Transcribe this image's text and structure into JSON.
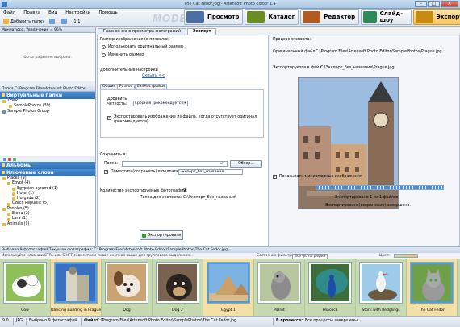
{
  "window": {
    "title": "The Cat Fedor.jpg - Artensoft Photo Editor 1.4",
    "buttons": [
      "–",
      "□",
      "✕"
    ]
  },
  "menu": [
    "Файл",
    "Правка",
    "Вид",
    "Настройки",
    "Помощь"
  ],
  "toolbar": {
    "add_label": "Добавить папку",
    "zoom": "1:1"
  },
  "mode_label": "MODE:",
  "modes": [
    {
      "label": "Просмотр",
      "color": "#4a6fa5"
    },
    {
      "label": "Каталог",
      "color": "#6b8e23"
    },
    {
      "label": "Редактор",
      "color": "#b35a1f"
    },
    {
      "label": "Слайд-шоу",
      "color": "#2e8b57"
    },
    {
      "label": "Экспорт",
      "color": "#c78a12",
      "active": true
    }
  ],
  "left": {
    "preview_header": "Миниатюра. Увеличение = 96%",
    "preview_empty": "Фотография не выбрана.",
    "folder_header": "Папка C:\\Program Files\\Artensoft Photo Editor...",
    "virtual_title": "Виртуальные папки",
    "virtual_tree": [
      "TEMP",
      "SamplePhotos (39)",
      "Sample Photos Group"
    ],
    "albums_title": "Альбомы",
    "keywords_title": "Ключевые слова",
    "keywords_tree": [
      "Places (9)",
      "Egypt (4)",
      "Egyptian pyramid (1)",
      "Hotel (1)",
      "Hurgada (2)",
      "Czech Republic (5)",
      "Peoples (5)",
      "Elena (2)",
      "Lara (1)",
      "Animals (9)"
    ]
  },
  "tabs": [
    "Главное окно просмотра фотографий",
    "Экспорт"
  ],
  "settings": {
    "size_title": "Размер изображения (в пикселях)",
    "size_options": [
      "Использовать оригинальный размер",
      "Изменить размер"
    ],
    "extra_title": "Дополнительные настройки",
    "hide_link": "Скрыть <<",
    "subtabs": [
      "Общие",
      "Разное",
      "ExifНастройки"
    ],
    "quality_label": "Добавить четкость:",
    "quality_value": "Средняя (рекомендуется)",
    "exif_check": "Экспортировать изображение из файла, когда отсутствует оригинал (рекомендуется)",
    "save_title": "Сохранить в:",
    "folder_label": "Папка:",
    "folder_value": "C:\\",
    "browse_label": "Обзор...",
    "subfolder_check": "Поместить(сохранить) в подпапку:",
    "subfolder_value": "Экспорт_без_названия",
    "count_label": "Количество экспортируемых фотографий:",
    "count_value": "9",
    "target_label": "Папка для экспорта:",
    "target_value": "C:\\Экспорт_без_названия\\",
    "export_button": "Экспортировать"
  },
  "process": {
    "title": "Процесс экспорта:",
    "original_label": "Оригинальный файл:",
    "original_value": "C:\\Program Files\\Artensoft Photo Editor\\SamplePhotos\\Prague.jpg",
    "exported_label": "Экспортируется в файл:",
    "exported_value": "C:\\Экспорт_без_названия\\Prague.jpg",
    "thumb_check": "Показывать миниатюрные изображения",
    "progress_text": "Экспортировано 1 из 1 файлов",
    "done_text": "Экспортировано(сохранение) завершено.",
    "progress": 1.0
  },
  "strip": {
    "bar_text": "Выбрано 9 фотографий  Текущая фотография: C:\\Program Files\\Artensoft Photo Editor\\SamplePhotos\\The Cat Fedor.jpg",
    "info_text": "Используйте клавиши CTRL или SHIFT совместно с левой кнопкой мыши для группового выделения...",
    "filter_label": "Состояние фильтра:",
    "filter_value": "Все фотографии",
    "color_label": "Цвет:",
    "items": [
      {
        "caption": "Cow",
        "scene": "cow"
      },
      {
        "caption": "Dancing Building in Prague",
        "scene": "building",
        "selected": true
      },
      {
        "caption": "Dog",
        "scene": "dog"
      },
      {
        "caption": "Dog 2",
        "scene": "dog2"
      },
      {
        "caption": "Egypt 1",
        "scene": "egypt",
        "selected": true
      },
      {
        "caption": "Parrot",
        "scene": "parrot"
      },
      {
        "caption": "Peacock",
        "scene": "peacock"
      },
      {
        "caption": "Stork with fledglings",
        "scene": "stork"
      },
      {
        "caption": "The Cat Fedor",
        "scene": "cat",
        "selected": true
      }
    ]
  },
  "status": {
    "format": "JPG",
    "selected": "Выбрано 9 фотографий",
    "file_label": "Файл:",
    "file_value": "C:\\Program Files\\Artensoft Photo Editor\\SamplePhotos\\The Cat Fedor.jpg",
    "process_label": "В процессе:",
    "process_value": "Все процессы завершены..."
  }
}
